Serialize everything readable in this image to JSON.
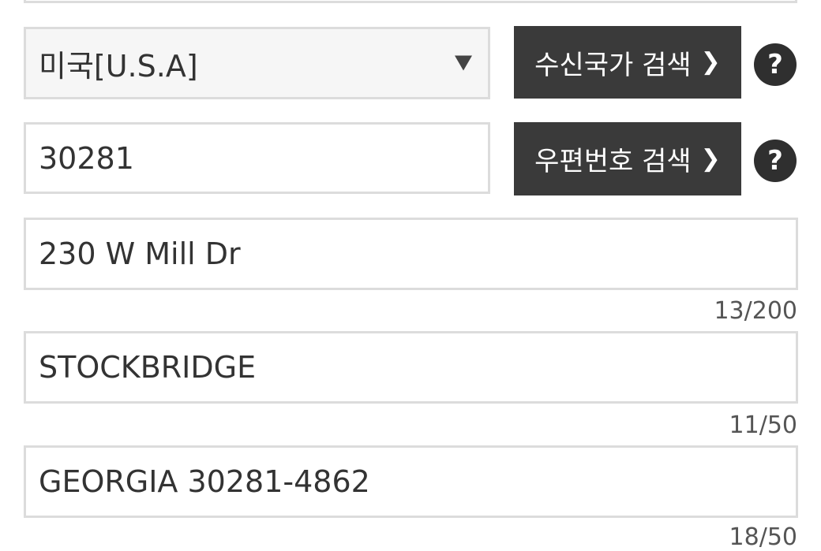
{
  "country": {
    "selected": "미국[U.S.A]",
    "search_button": "수신국가 검색",
    "chevron": "❯",
    "help": "?"
  },
  "postal": {
    "value": "30281",
    "search_button": "우편번호 검색",
    "chevron": "❯",
    "help": "?"
  },
  "address_line": {
    "value": "230 W Mill Dr",
    "counter": "13/200"
  },
  "city": {
    "value": "STOCKBRIDGE",
    "counter": "11/50"
  },
  "state": {
    "value": "GEORGIA 30281-4862",
    "counter": "18/50"
  }
}
